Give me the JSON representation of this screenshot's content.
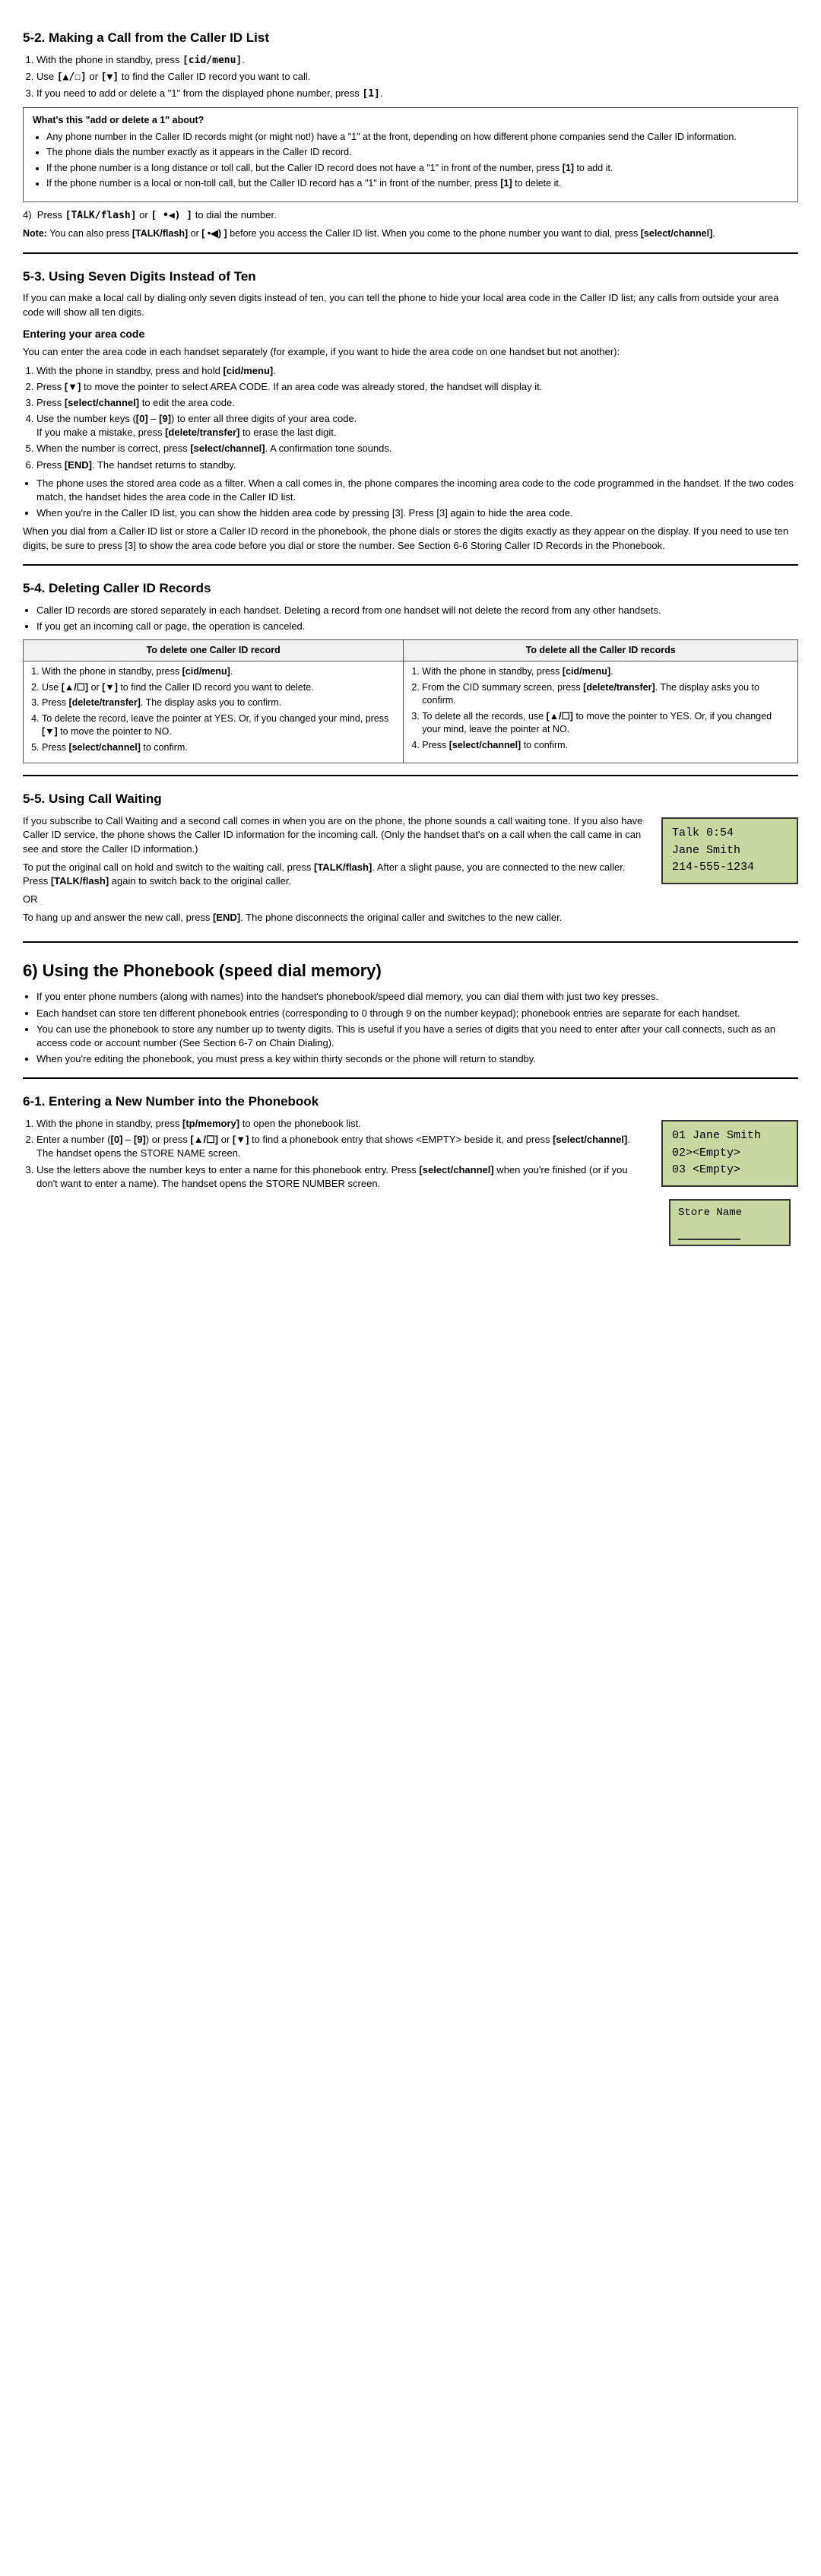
{
  "sections": {
    "s5_2": {
      "title": "5-2. Making a Call from the Caller ID List",
      "steps": [
        "With the phone in standby, press <strong>[cid/menu]</strong>.",
        "Use <strong>[▲/☐]</strong> or <strong>[▼]</strong> to find the Caller ID record you want to call.",
        "If you need to add or delete a \"1\" from the displayed phone number, press <strong>[1]</strong>."
      ],
      "infobox": {
        "title": "What's this \"add or delete a 1\" about?",
        "items": [
          "Any phone number in the Caller ID records might (or might not!) have a \"1\" at the front, depending on how different phone companies send the Caller ID information.",
          "The phone dials the number exactly as it appears in the Caller ID record.",
          "If the phone number is a long distance or toll call, but the Caller ID record does not have a \"1\" in front of the number, press [1] to add it.",
          "If the phone number is a local or non-toll call, but the Caller ID record has a \"1\" in front of the number, press [1] to delete it."
        ]
      },
      "step4": "Press <strong>[TALK/flash]</strong> or <strong>[ •◀) ]</strong> to dial the number.",
      "note": "Note: You can also press <strong>[TALK/flash]</strong> or <strong>[ •◀) ]</strong> before you access the Caller ID list. When you come to the phone number you want to dial, press <strong>[select/channel]</strong>."
    },
    "s5_3": {
      "title": "5-3. Using Seven Digits Instead of Ten",
      "intro": "If you can make a local call by dialing only seven digits instead of ten, you can tell the phone to hide your local area code in the Caller ID list; any calls from outside your area code will show all ten digits.",
      "subheading": "Entering your area code",
      "subintro": "You can enter the area code in each handset separately (for example, if you want to hide the area code on one handset but not another):",
      "steps": [
        "With the phone in standby, press and hold <strong>[cid/menu]</strong>.",
        "Press <strong>[▼]</strong> to move the pointer to select AREA CODE. If an area code was already stored, the handset will display it.",
        "Press <strong>[select/channel]</strong> to edit the area code.",
        "Use the number keys (<strong>[0]</strong> – <strong>[9]</strong>) to enter all three digits of your area code. If you make a mistake, press <strong>[delete/transfer]</strong> to erase the last digit.",
        "When the number is correct, press <strong>[select/channel]</strong>. A confirmation tone sounds.",
        "Press <strong>[END]</strong>. The handset returns to standby."
      ],
      "bullets": [
        "The phone uses the stored area code as a filter. When a call comes in, the phone compares the incoming area code to the code programmed in the handset. If the two codes match, the handset hides the area code in the Caller ID list.",
        "When you're in the Caller ID list, you can show the hidden area code by pressing [3]. Press [3] again to hide the area code."
      ],
      "closing": "When you dial from a Caller ID list or store a Caller ID record in the phonebook, the phone dials or stores the digits exactly as they appear on the display. If you need to use ten digits, be sure to press [3] to show the area code before you dial or store the number. See Section 6-6 Storing Caller ID Records in the Phonebook."
    },
    "s5_4": {
      "title": "5-4. Deleting Caller ID Records",
      "intro1": "Caller ID records are stored separately in each handset. Deleting a record from one handset will not delete the record from any other handsets.",
      "bullet1": "If you get an incoming call or page, the operation is canceled.",
      "table": {
        "col1_header": "To delete one Caller ID record",
        "col2_header": "To delete all the Caller ID records",
        "col1_steps": [
          "With the phone in standby, press <strong>[cid/menu]</strong>.",
          "Use <strong>[▲/☐]</strong> or <strong>[▼]</strong> to find the Caller ID record you want to delete.",
          "Press <strong>[delete/transfer]</strong>. The display asks you to confirm.",
          "To delete the record, leave the pointer at YES. Or, if you changed your mind, press <strong>[▼]</strong> to move the pointer to NO.",
          "Press <strong>[select/channel]</strong> to confirm."
        ],
        "col2_steps": [
          "With the phone in standby, press <strong>[cid/menu]</strong>.",
          "From the CID summary screen, press <strong>[delete/transfer]</strong>. The display asks you to confirm.",
          "To delete all the records, use <strong>[▲/☐]</strong> to move the pointer to YES. Or, if you changed your mind, leave the pointer at NO.",
          "Press <strong>[select/channel]</strong> to confirm."
        ]
      }
    },
    "s5_5": {
      "title": "5-5. Using Call Waiting",
      "intro": "If you subscribe to Call Waiting and a second call comes in when you are on the phone, the phone sounds a call waiting tone. If you also have Caller ID service, the phone shows the Caller ID information for the incoming call. (Only the handset that's on a call when the call came in can see and store the Caller ID information.)",
      "para2": "To put the original call on hold and switch to the waiting call, press <strong>[TALK/flash]</strong>. After a slight pause, you are connected to the new caller. Press <strong>[TALK/flash]</strong> again to switch back to the original caller.",
      "or": "OR",
      "para3": "To hang up and answer the new call, press <strong>[END]</strong>. The phone disconnects the original caller and switches to the new caller.",
      "screen": {
        "line1": "Talk    0:54",
        "line2": "Jane Smith",
        "line3": "214-555-1234"
      }
    },
    "s6": {
      "title": "6) Using the Phonebook (speed dial memory)",
      "bullets": [
        "If you enter phone numbers (along with names) into the handset's phonebook/speed dial memory, you can dial them with just two key presses.",
        "Each handset can store ten different phonebook entries (corresponding to 0 through 9 on the number keypad); phonebook entries are separate for each handset.",
        "You can use the phonebook to store any number up to twenty digits. This is useful if you have a series of digits that you need to enter after your call connects, such as an access code or account number (See Section 6-7 on Chain Dialing).",
        "When you're editing the phonebook, you must press a key within thirty seconds or the phone will return to standby."
      ]
    },
    "s6_1": {
      "title": "6-1. Entering a New Number into the Phonebook",
      "steps": [
        "With the phone in standby, press <strong>[tp/memory]</strong> to open the phonebook list.",
        "Enter a number (<strong>[0]</strong> – <strong>[9]</strong>) or press <strong>[▲/☐]</strong> or <strong>[▼]</strong> to find a phonebook entry that shows &lt;EMPTY&gt; beside it, and press <strong>[select/channel]</strong>. The handset opens the STORE NAME screen.",
        "Use the letters above the number keys to enter a name for this phonebook entry. Press <strong>[select/channel]</strong> when you're finished (or if you don't want to enter a name). The handset opens the STORE NUMBER screen."
      ],
      "screen1": {
        "line1": "01 Jane Smith",
        "line2": "02><Empty>",
        "line3": "03 <Empty>"
      },
      "screen2": {
        "line1": "Store Name"
      }
    }
  }
}
